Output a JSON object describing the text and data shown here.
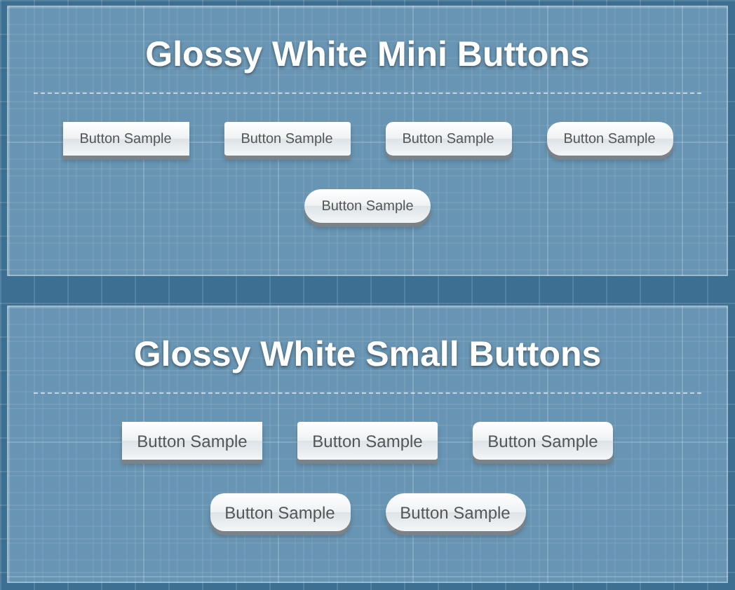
{
  "panels": [
    {
      "title": "Glossy White Mini Buttons",
      "kind": "mini",
      "buttons": [
        {
          "label": "Button Sample",
          "kind": "square"
        },
        {
          "label": "Button Sample",
          "kind": "slight"
        },
        {
          "label": "Button Sample",
          "kind": "rounded"
        },
        {
          "label": "Button Sample",
          "kind": "round"
        },
        {
          "label": "Button Sample",
          "kind": "pill"
        }
      ]
    },
    {
      "title": "Glossy White Small Buttons",
      "kind": "small",
      "buttons": [
        {
          "label": "Button Sample",
          "kind": "square"
        },
        {
          "label": "Button Sample",
          "kind": "slight"
        },
        {
          "label": "Button Sample",
          "kind": "rounded"
        },
        {
          "label": "Button Sample",
          "kind": "round"
        },
        {
          "label": "Button Sample",
          "kind": "pill"
        }
      ]
    }
  ]
}
